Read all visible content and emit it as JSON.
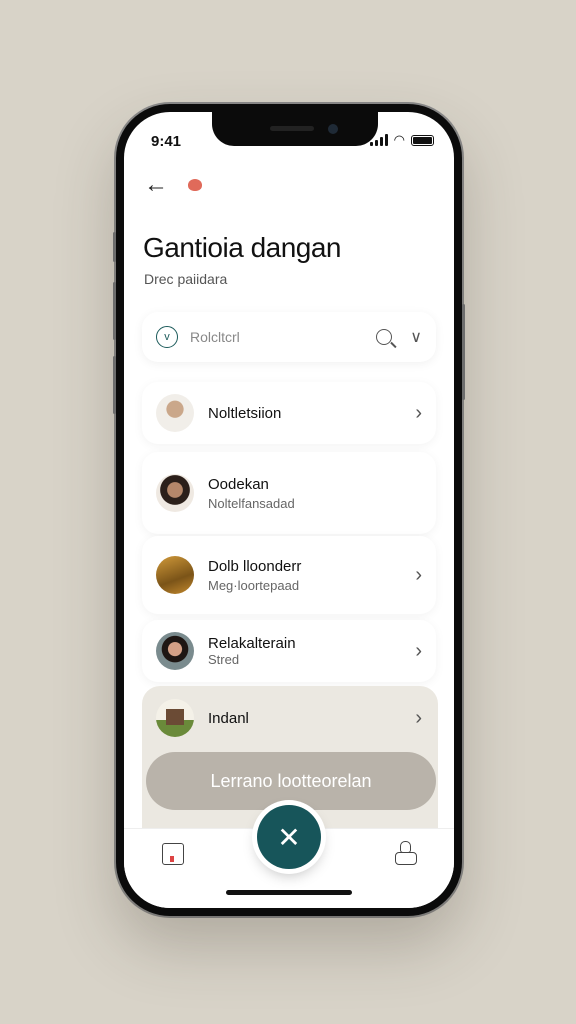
{
  "status": {
    "time": "9:41"
  },
  "header": {
    "title": "Gantioia dangan",
    "subtitle": "Drec paiidara"
  },
  "search": {
    "text": "Rolcltcrl"
  },
  "items": [
    {
      "name": "Noltletsiion",
      "sub": ""
    },
    {
      "name": "Oodekan",
      "sub": "Noltelfansadad"
    },
    {
      "name": "Dolb lloonderr",
      "sub": "Meg·loortepaad"
    },
    {
      "name": "Relakalterain",
      "sub": "Stred"
    },
    {
      "name": "Indanl",
      "sub": ""
    }
  ],
  "cta": {
    "label": "Lerrano lootteorelan"
  },
  "colors": {
    "accent": "#17555a",
    "cta": "#b9b3aa",
    "background": "#d8d3c8"
  }
}
